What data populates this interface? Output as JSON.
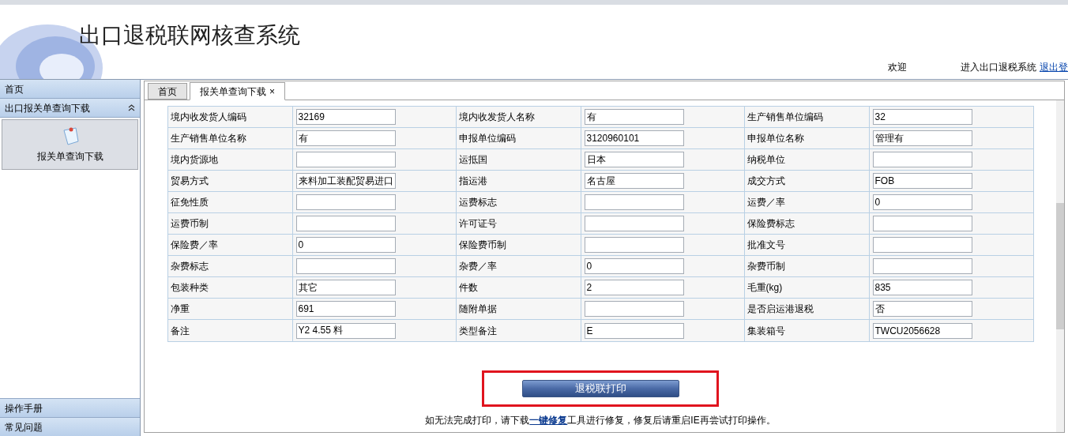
{
  "header": {
    "title": "出口退税联网核查系统",
    "welcome": "欢迎",
    "welcome_suffix": "进入出口退税系统",
    "logout": "退出登"
  },
  "sidebar": {
    "top": [
      {
        "label": "首页"
      }
    ],
    "section": {
      "label": "出口报关单查询下载",
      "expanded": true,
      "items": [
        {
          "label": "报关单查询下载"
        }
      ]
    },
    "bottom": [
      {
        "label": "操作手册"
      },
      {
        "label": "常见问题"
      }
    ]
  },
  "tabs": [
    {
      "label": "首页",
      "selected": false
    },
    {
      "label": "报关单查询下载",
      "selected": true,
      "close": "×"
    }
  ],
  "form": {
    "rows": [
      [
        {
          "label": "境内收发货人编码",
          "value": "32169"
        },
        {
          "label": "境内收发货人名称",
          "value": "有"
        },
        {
          "label": "生产销售单位编码",
          "value": "32"
        }
      ],
      [
        {
          "label": "生产销售单位名称",
          "value": "有"
        },
        {
          "label": "申报单位编码",
          "value": "3120960101"
        },
        {
          "label": "申报单位名称",
          "value": "管理有"
        }
      ],
      [
        {
          "label": "境内货源地"
        },
        {
          "label": "运抵国",
          "value": "日本"
        },
        {
          "label": "纳税单位"
        }
      ],
      [
        {
          "label": "贸易方式",
          "value": "来料加工装配贸易进口"
        },
        {
          "label": "指运港",
          "value": "名古屋"
        },
        {
          "label": "成交方式",
          "value": "FOB"
        }
      ],
      [
        {
          "label": "征免性质"
        },
        {
          "label": "运费标志"
        },
        {
          "label": "运费／率",
          "value": "0"
        }
      ],
      [
        {
          "label": "运费币制"
        },
        {
          "label": "许可证号"
        },
        {
          "label": "保险费标志"
        }
      ],
      [
        {
          "label": "保险费／率",
          "value": "0"
        },
        {
          "label": "保险费币制"
        },
        {
          "label": "批准文号"
        }
      ],
      [
        {
          "label": "杂费标志"
        },
        {
          "label": "杂费／率",
          "value": "0"
        },
        {
          "label": "杂费币制"
        }
      ],
      [
        {
          "label": "包装种类",
          "value": "其它"
        },
        {
          "label": "件数",
          "value": "2"
        },
        {
          "label": "毛重(kg)",
          "value": "835"
        }
      ],
      [
        {
          "label": "净重",
          "value": "691"
        },
        {
          "label": "随附单据"
        },
        {
          "label": "是否启运港退税",
          "value": "否"
        }
      ],
      [
        {
          "label": "备注",
          "value": "Y2 4.55 料"
        },
        {
          "label": "类型备注",
          "value": "E"
        },
        {
          "label": "集装箱号",
          "value": "TWCU2056628"
        }
      ]
    ]
  },
  "print_button": "退税联打印",
  "footer": {
    "before": "如无法完成打印，请下载",
    "link": "一键修复",
    "after": "工具进行修复，修复后请重启IE再尝试打印操作。"
  }
}
